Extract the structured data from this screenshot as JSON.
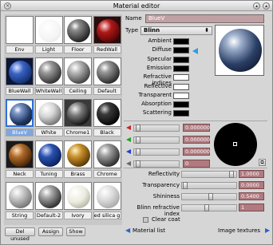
{
  "window": {
    "title": "Material editor"
  },
  "materials": [
    {
      "name": "Env"
    },
    {
      "name": "Light"
    },
    {
      "name": "Floor"
    },
    {
      "name": "RedWall"
    },
    {
      "name": "BlueWall"
    },
    {
      "name": "WhiteWall"
    },
    {
      "name": "Ceiling"
    },
    {
      "name": "Default"
    },
    {
      "name": "BlueV",
      "selected": true
    },
    {
      "name": "White"
    },
    {
      "name": "Chrome1"
    },
    {
      "name": "Black"
    },
    {
      "name": "Neck"
    },
    {
      "name": "Tuning"
    },
    {
      "name": "Brass"
    },
    {
      "name": "Chrome"
    },
    {
      "name": "String"
    },
    {
      "name": "Default-2"
    },
    {
      "name": "Ivory"
    },
    {
      "name": "ed silica g"
    }
  ],
  "buttons": {
    "del_unused": "Del unused",
    "assign": "Assign",
    "show": "Show"
  },
  "props": {
    "name_label": "Name",
    "name_value": "BlueV",
    "type_label": "Type",
    "type_value": "Blinn",
    "colors": [
      {
        "label": "Ambient",
        "color": "#000000"
      },
      {
        "label": "Diffuse",
        "color": "#000000"
      },
      {
        "label": "Specular",
        "color": "#000000"
      },
      {
        "label": "Emission",
        "color": "#000000"
      },
      {
        "label": "Refractive indices",
        "color": "#ffffff"
      },
      {
        "label": "Reflective",
        "color": "#ffffff"
      },
      {
        "label": "Transparent",
        "color": "#ffffff"
      },
      {
        "label": "Absorption",
        "color": "#000000"
      },
      {
        "label": "Scattering",
        "color": "#000000"
      }
    ]
  },
  "rgb": {
    "r": "0.000000",
    "g": "0.000000",
    "b": "0.000000",
    "a": "0"
  },
  "params": [
    {
      "label": "Reflectivity",
      "value": "1.0000",
      "level": 0.95
    },
    {
      "label": "Transparency",
      "value": "0.0000",
      "level": 0.02
    },
    {
      "label": "Shininess",
      "value": "0.5400",
      "level": 0.54
    },
    {
      "label": "Blinn refractive index",
      "value": "1",
      "level": 0.45
    }
  ],
  "clear_coat": "Clear coat",
  "footer": {
    "material_list": "Material list",
    "image_textures": "Image textures"
  }
}
